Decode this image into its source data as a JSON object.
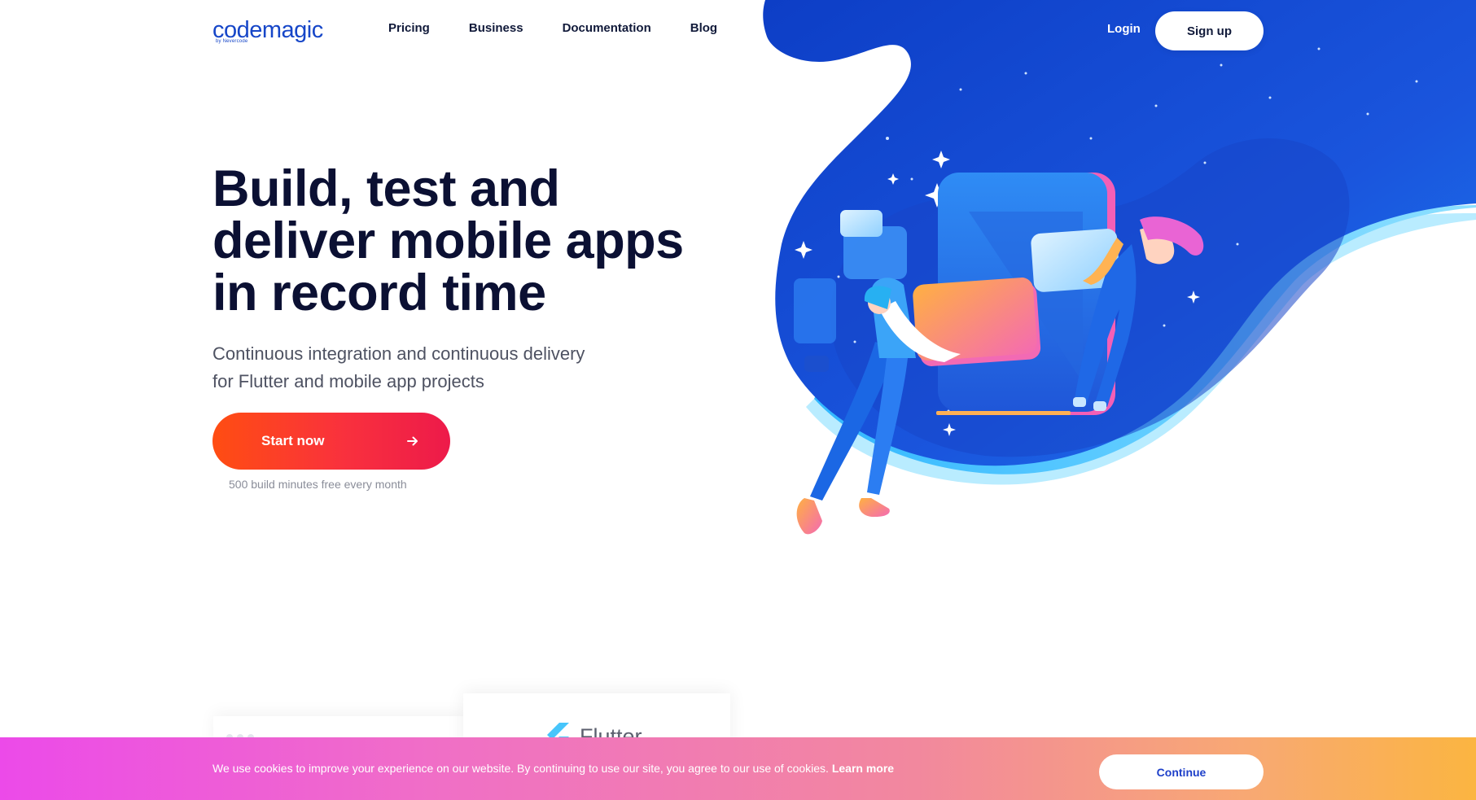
{
  "brand": {
    "logo_text": "codemagic",
    "logo_sub": "by Nevercode",
    "accent": "#1646c8"
  },
  "nav": {
    "items": [
      {
        "label": "Pricing"
      },
      {
        "label": "Business"
      },
      {
        "label": "Documentation"
      },
      {
        "label": "Blog"
      }
    ],
    "login_label": "Login",
    "signup_label": "Sign up"
  },
  "hero": {
    "title_lines": [
      "Build, test and",
      "deliver mobile apps",
      "in record time"
    ],
    "subtitle_lines": [
      "Continuous integration and continuous delivery",
      "for Flutter and mobile app projects"
    ],
    "cta_label": "Start now",
    "cta_icon": "arrow-right-icon",
    "cta_note": "500 build minutes free every month",
    "cta_color_start": "#ff4d12",
    "cta_color_end": "#ed1a4a"
  },
  "cards": {
    "flutter_label": "Flutter",
    "flutter_icon": "flutter-logo-icon"
  },
  "cookie_banner": {
    "message": "We use cookies to improve your experience on our website. By continuing to use our site, you agree to our use of cookies.",
    "link_label": "Learn more",
    "button_label": "Continue"
  }
}
